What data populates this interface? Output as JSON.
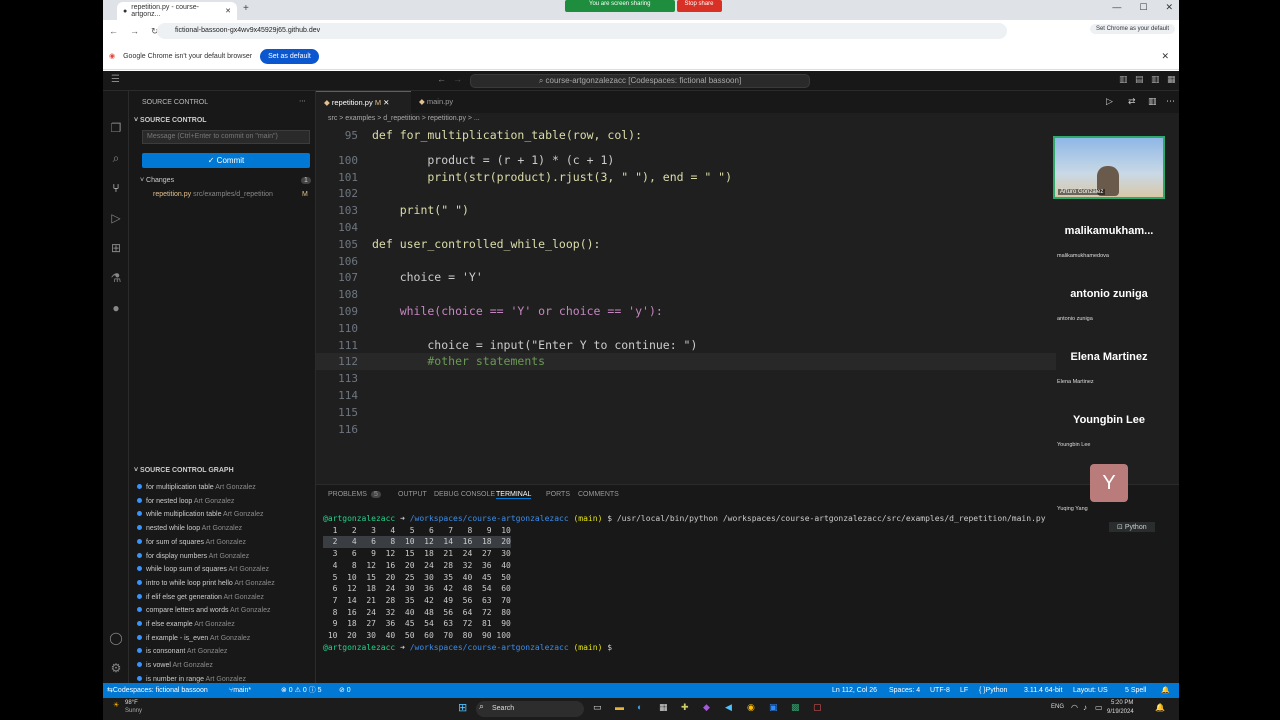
{
  "browser": {
    "tab_title": "repetition.py - course-artgonz...",
    "share_message": "You are screen sharing",
    "stop_share": "Stop share",
    "url": "fictional-bassoon-gx4wv9x45929j65.github.dev",
    "set_chrome_label": "Set Chrome as your default",
    "info_message": "Google Chrome isn't your default browser",
    "set_default_button": "Set as default"
  },
  "vscode": {
    "command_center": "course-artgonzalezacc [Codespaces: fictional bassoon]",
    "sidebar": {
      "title": "SOURCE CONTROL",
      "section": "SOURCE CONTROL",
      "message_placeholder": "Message (Ctrl+Enter to commit on \"main\")",
      "commit_label": "✓ Commit",
      "changes_label": "Changes",
      "changes_count": "1",
      "change_file": "repetition.py",
      "change_path": "src/examples/d_repetition",
      "change_status": "M",
      "graph_title": "SOURCE CONTROL GRAPH",
      "graph_items": [
        {
          "msg": "for multiplication table",
          "author": "Art Gonzalez"
        },
        {
          "msg": "for nested loop",
          "author": "Art Gonzalez"
        },
        {
          "msg": "while multiplication table",
          "author": "Art Gonzalez"
        },
        {
          "msg": "nested while loop",
          "author": "Art Gonzalez"
        },
        {
          "msg": "for sum of squares",
          "author": "Art Gonzalez"
        },
        {
          "msg": "for display numbers",
          "author": "Art Gonzalez"
        },
        {
          "msg": "while loop sum of squares",
          "author": "Art Gonzalez"
        },
        {
          "msg": "intro to while loop print hello",
          "author": "Art Gonzalez"
        },
        {
          "msg": "if elif else get generation",
          "author": "Art Gonzalez"
        },
        {
          "msg": "compare letters and words",
          "author": "Art Gonzalez"
        },
        {
          "msg": "if else example",
          "author": "Art Gonzalez"
        },
        {
          "msg": "if example - is_even",
          "author": "Art Gonzalez"
        },
        {
          "msg": "is consonant",
          "author": "Art Gonzalez"
        },
        {
          "msg": "is vowel",
          "author": "Art Gonzalez"
        },
        {
          "msg": "is number in range",
          "author": "Art Gonzalez"
        }
      ]
    },
    "tabs": [
      {
        "label": "repetition.py",
        "status": "M"
      },
      {
        "label": "main.py"
      }
    ],
    "breadcrumb": "src > examples > d_repetition > repetition.py > ...",
    "code": [
      {
        "n": "95",
        "text": "def for_multiplication_table(row, col):"
      },
      {
        "n": "100",
        "text": "        product = (r + 1) * (c + 1)"
      },
      {
        "n": "101",
        "text": "        print(str(product).rjust(3, \" \"), end = \" \")"
      },
      {
        "n": "102",
        "text": ""
      },
      {
        "n": "103",
        "text": "    print(\" \")"
      },
      {
        "n": "104",
        "text": ""
      },
      {
        "n": "105",
        "text": "def user_controlled_while_loop():"
      },
      {
        "n": "106",
        "text": ""
      },
      {
        "n": "107",
        "text": "    choice = 'Y'"
      },
      {
        "n": "108",
        "text": ""
      },
      {
        "n": "109",
        "text": "    while(choice == 'Y' or choice == 'y'):"
      },
      {
        "n": "110",
        "text": ""
      },
      {
        "n": "111",
        "text": "        choice = input(\"Enter Y to continue: \")"
      },
      {
        "n": "112",
        "text": "        #other statements"
      },
      {
        "n": "113",
        "text": ""
      },
      {
        "n": "114",
        "text": ""
      },
      {
        "n": "115",
        "text": ""
      },
      {
        "n": "116",
        "text": ""
      }
    ],
    "panel": {
      "tabs": [
        "PROBLEMS",
        "OUTPUT",
        "DEBUG CONSOLE",
        "TERMINAL",
        "PORTS",
        "COMMENTS"
      ],
      "problems_count": "5",
      "terminal_name": "Python",
      "prompt_user": "@artgonzalezacc",
      "prompt_path": "/workspaces/course-artgonzalezacc",
      "prompt_branch": "(main)",
      "command": "$ /usr/local/bin/python /workspaces/course-artgonzalezacc/src/examples/d_repetition/main.py",
      "table_rows": [
        "  1   2   3   4   5   6   7   8   9  10",
        "  2   4   6   8  10  12  14  16  18  20",
        "  3   6   9  12  15  18  21  24  27  30",
        "  4   8  12  16  20  24  28  32  36  40",
        "  5  10  15  20  25  30  35  40  45  50",
        "  6  12  18  24  30  36  42  48  54  60",
        "  7  14  21  28  35  42  49  56  63  70",
        "  8  16  24  32  40  48  56  64  72  80",
        "  9  18  27  36  45  54  63  72  81  90",
        " 10  20  30  40  50  60  70  80  90 100"
      ],
      "end_prompt": "$ "
    },
    "status": {
      "remote": "Codespaces: fictional bassoon",
      "branch": "main*",
      "problems": "⊗ 0 ⚠ 0 ⓘ 5",
      "ports": "⊘ 0",
      "position": "Ln 112, Col 26",
      "spaces": "Spaces: 4",
      "encoding": "UTF-8",
      "eol": "LF",
      "language": "Python",
      "interpreter": "3.11.4 64-bit",
      "layout": "Layout: US",
      "spell": "5 Spell"
    }
  },
  "participants": {
    "video_name": "Arturo Gonzalez",
    "people": [
      {
        "display": "malikamukham...",
        "sub": "malikamukhamedova"
      },
      {
        "display": "antonio zuniga",
        "sub": "antonio zuniga"
      },
      {
        "display": "Elena Martinez",
        "sub": "Elena Martinez"
      },
      {
        "display": "Youngbin Lee",
        "sub": "Youngbin Lee"
      }
    ],
    "avatar_letter": "Y",
    "last_sub": "Yuqing Yang"
  },
  "taskbar": {
    "weather_temp": "98°F",
    "weather_desc": "Sunny",
    "search_label": "Search",
    "lang": "ENG",
    "time": "5:20 PM",
    "date": "9/19/2024"
  }
}
